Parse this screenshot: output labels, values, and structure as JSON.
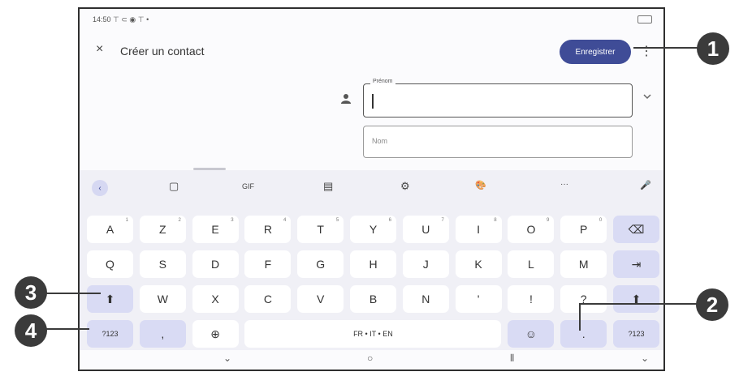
{
  "status": {
    "time": "14:50",
    "indicators": "⊤ ⊂ ◉ ⊤ •"
  },
  "appbar": {
    "close_icon": "×",
    "title": "Créer un contact",
    "save_label": "Enregistrer",
    "menu_icon": "⋮"
  },
  "form": {
    "first_field_label": "Prénom",
    "second_field_placeholder": "Nom",
    "expand_icon": "chevron-down-icon"
  },
  "toolbar": {
    "back": "‹",
    "items": [
      "▢",
      "GIF",
      "▤",
      "⚙",
      "🎨",
      "···",
      "🎤"
    ]
  },
  "keyboard": {
    "row1": [
      {
        "k": "A",
        "s": "1"
      },
      {
        "k": "Z",
        "s": "2"
      },
      {
        "k": "E",
        "s": "3"
      },
      {
        "k": "R",
        "s": "4"
      },
      {
        "k": "T",
        "s": "5"
      },
      {
        "k": "Y",
        "s": "6"
      },
      {
        "k": "U",
        "s": "7"
      },
      {
        "k": "I",
        "s": "8"
      },
      {
        "k": "O",
        "s": "9"
      },
      {
        "k": "P",
        "s": "0"
      }
    ],
    "backspace": "⌫",
    "row2": [
      "Q",
      "S",
      "D",
      "F",
      "G",
      "H",
      "J",
      "K",
      "L",
      "M"
    ],
    "enter": "⇥",
    "shift": "⬆",
    "row3": [
      "W",
      "X",
      "C",
      "V",
      "B",
      "N",
      "'",
      "!",
      "?"
    ],
    "shift_right": "⬆",
    "symbols_left": "?123",
    "comma": ",",
    "globe": "⊕",
    "space": "FR • IT • EN",
    "emoji": "☺",
    "period": ".",
    "symbols_right": "?123"
  },
  "nav": {
    "back": "⌄",
    "home": "○",
    "recents": "⦀",
    "keyboard_down": "⌄"
  },
  "callouts": {
    "c1": "1",
    "c2": "2",
    "c3": "3",
    "c4": "4"
  }
}
